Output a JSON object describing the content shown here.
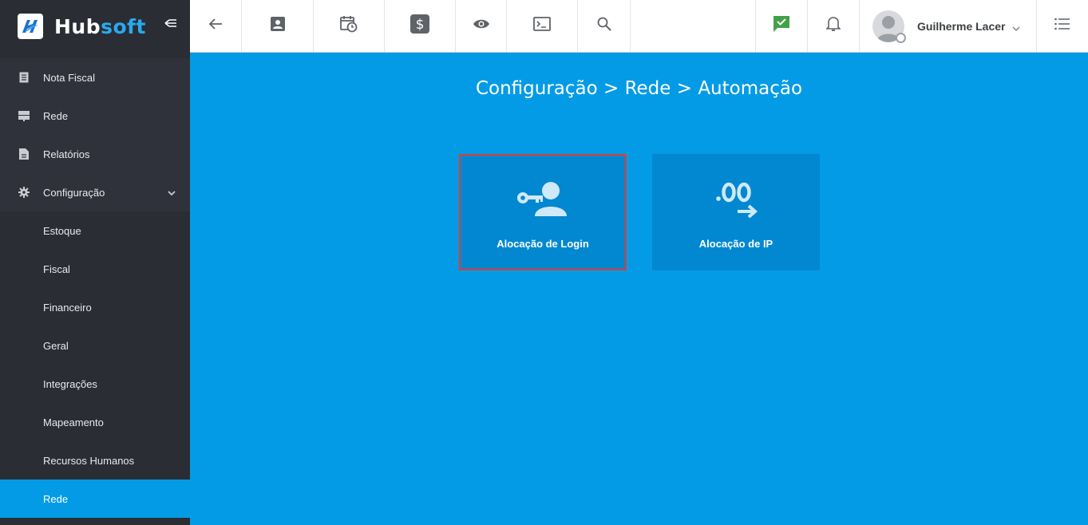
{
  "brand": {
    "name_part1": "Hub",
    "name_part2": "soft"
  },
  "sidebar": {
    "items": [
      {
        "label": "Nota Fiscal",
        "icon": "document-icon"
      },
      {
        "label": "Rede",
        "icon": "server-icon"
      },
      {
        "label": "Relatórios",
        "icon": "report-icon"
      },
      {
        "label": "Configuração",
        "icon": "gear-icon"
      }
    ],
    "sub_items": [
      {
        "label": "Estoque"
      },
      {
        "label": "Fiscal"
      },
      {
        "label": "Financeiro"
      },
      {
        "label": "Geral"
      },
      {
        "label": "Integrações"
      },
      {
        "label": "Mapeamento"
      },
      {
        "label": "Recursos Humanos"
      },
      {
        "label": "Rede"
      }
    ]
  },
  "topbar": {
    "icons": [
      "back-arrow-icon",
      "contact-card-icon",
      "calendar-clock-icon",
      "dollar-icon",
      "eye-icon",
      "terminal-icon",
      "search-icon",
      "chat-check-icon",
      "bell-icon",
      "list-menu-icon"
    ],
    "user_name": "Guilherme Lacer"
  },
  "main": {
    "breadcrumb": "Configuração > Rede > Automação",
    "cards": [
      {
        "label": "Alocação de Login",
        "icon": "key-user-icon",
        "selected": true
      },
      {
        "label": "Alocação de IP",
        "icon": "ip-arrow-icon",
        "selected": false
      }
    ]
  },
  "colors": {
    "sidebar_bg": "#2a2d34",
    "main_bg": "#039be5",
    "card_bg": "#0288d1",
    "highlight_border": "#e53935",
    "accent": "#29a9f0"
  }
}
